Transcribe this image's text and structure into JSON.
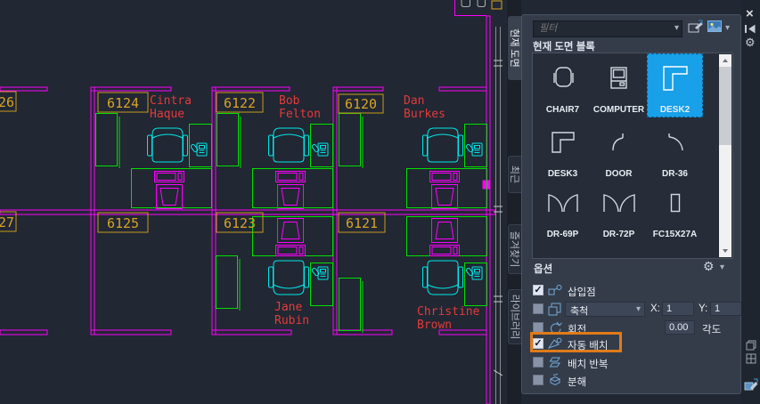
{
  "icons": {
    "check": "✓",
    "caret": "▾",
    "gear": "⚙",
    "close": "×"
  },
  "canvas": {
    "rooms": {
      "r26": {
        "number": "26"
      },
      "r27": {
        "number": "27"
      },
      "r6124": {
        "number": "6124",
        "first": "Cintra",
        "last": "Haque"
      },
      "r6122": {
        "number": "6122",
        "first": "Bob",
        "last": "Felton"
      },
      "r6120": {
        "number": "6120",
        "first": "Dan",
        "last": "Burkes"
      },
      "r6125": {
        "number": "6125"
      },
      "r6123": {
        "number": "6123",
        "first": "Jane",
        "last": "Rubin"
      },
      "r6121": {
        "number": "6121",
        "first": "Christine",
        "last": "Brown"
      }
    },
    "colors": {
      "wall": "#FF00FF",
      "furniture": "#00E000",
      "seat": "#00E8E8",
      "room_label": "#D8A425",
      "name": "#E23B3B",
      "corridor": "#8c8c8c"
    }
  },
  "palette": {
    "tabs": [
      {
        "label": "현재 도면",
        "active": true
      },
      {
        "label": "최근",
        "active": false
      },
      {
        "label": "즐겨찾기",
        "active": false
      },
      {
        "label": "라이브러리",
        "active": false
      }
    ],
    "filter_placeholder": "필터",
    "section_title": "현재 도면 블록",
    "blocks": [
      {
        "label": "CHAIR7",
        "selected": false
      },
      {
        "label": "COMPUTER",
        "selected": false
      },
      {
        "label": "DESK2",
        "selected": true
      },
      {
        "label": "DESK3",
        "selected": false
      },
      {
        "label": "DOOR",
        "selected": false
      },
      {
        "label": "DR-36",
        "selected": false
      },
      {
        "label": "DR-69P",
        "selected": false
      },
      {
        "label": "DR-72P",
        "selected": false
      },
      {
        "label": "FC15X27A",
        "selected": false
      }
    ],
    "options": {
      "title": "옵션",
      "insertion_label": "삽입점",
      "insertion_checked": true,
      "scale_value": "축척",
      "scale_checked": false,
      "x_label": "X:",
      "x_value": "1",
      "y_label": "Y:",
      "y_value": "1",
      "rotation_label": "회전",
      "rotation_checked": false,
      "angle_value": "0.00",
      "angle_label": "각도",
      "auto_place_label": "자동 배치",
      "auto_place_checked": true,
      "repeat_label": "배치 반복",
      "repeat_checked": false,
      "explode_label": "분해",
      "explode_checked": false
    }
  }
}
